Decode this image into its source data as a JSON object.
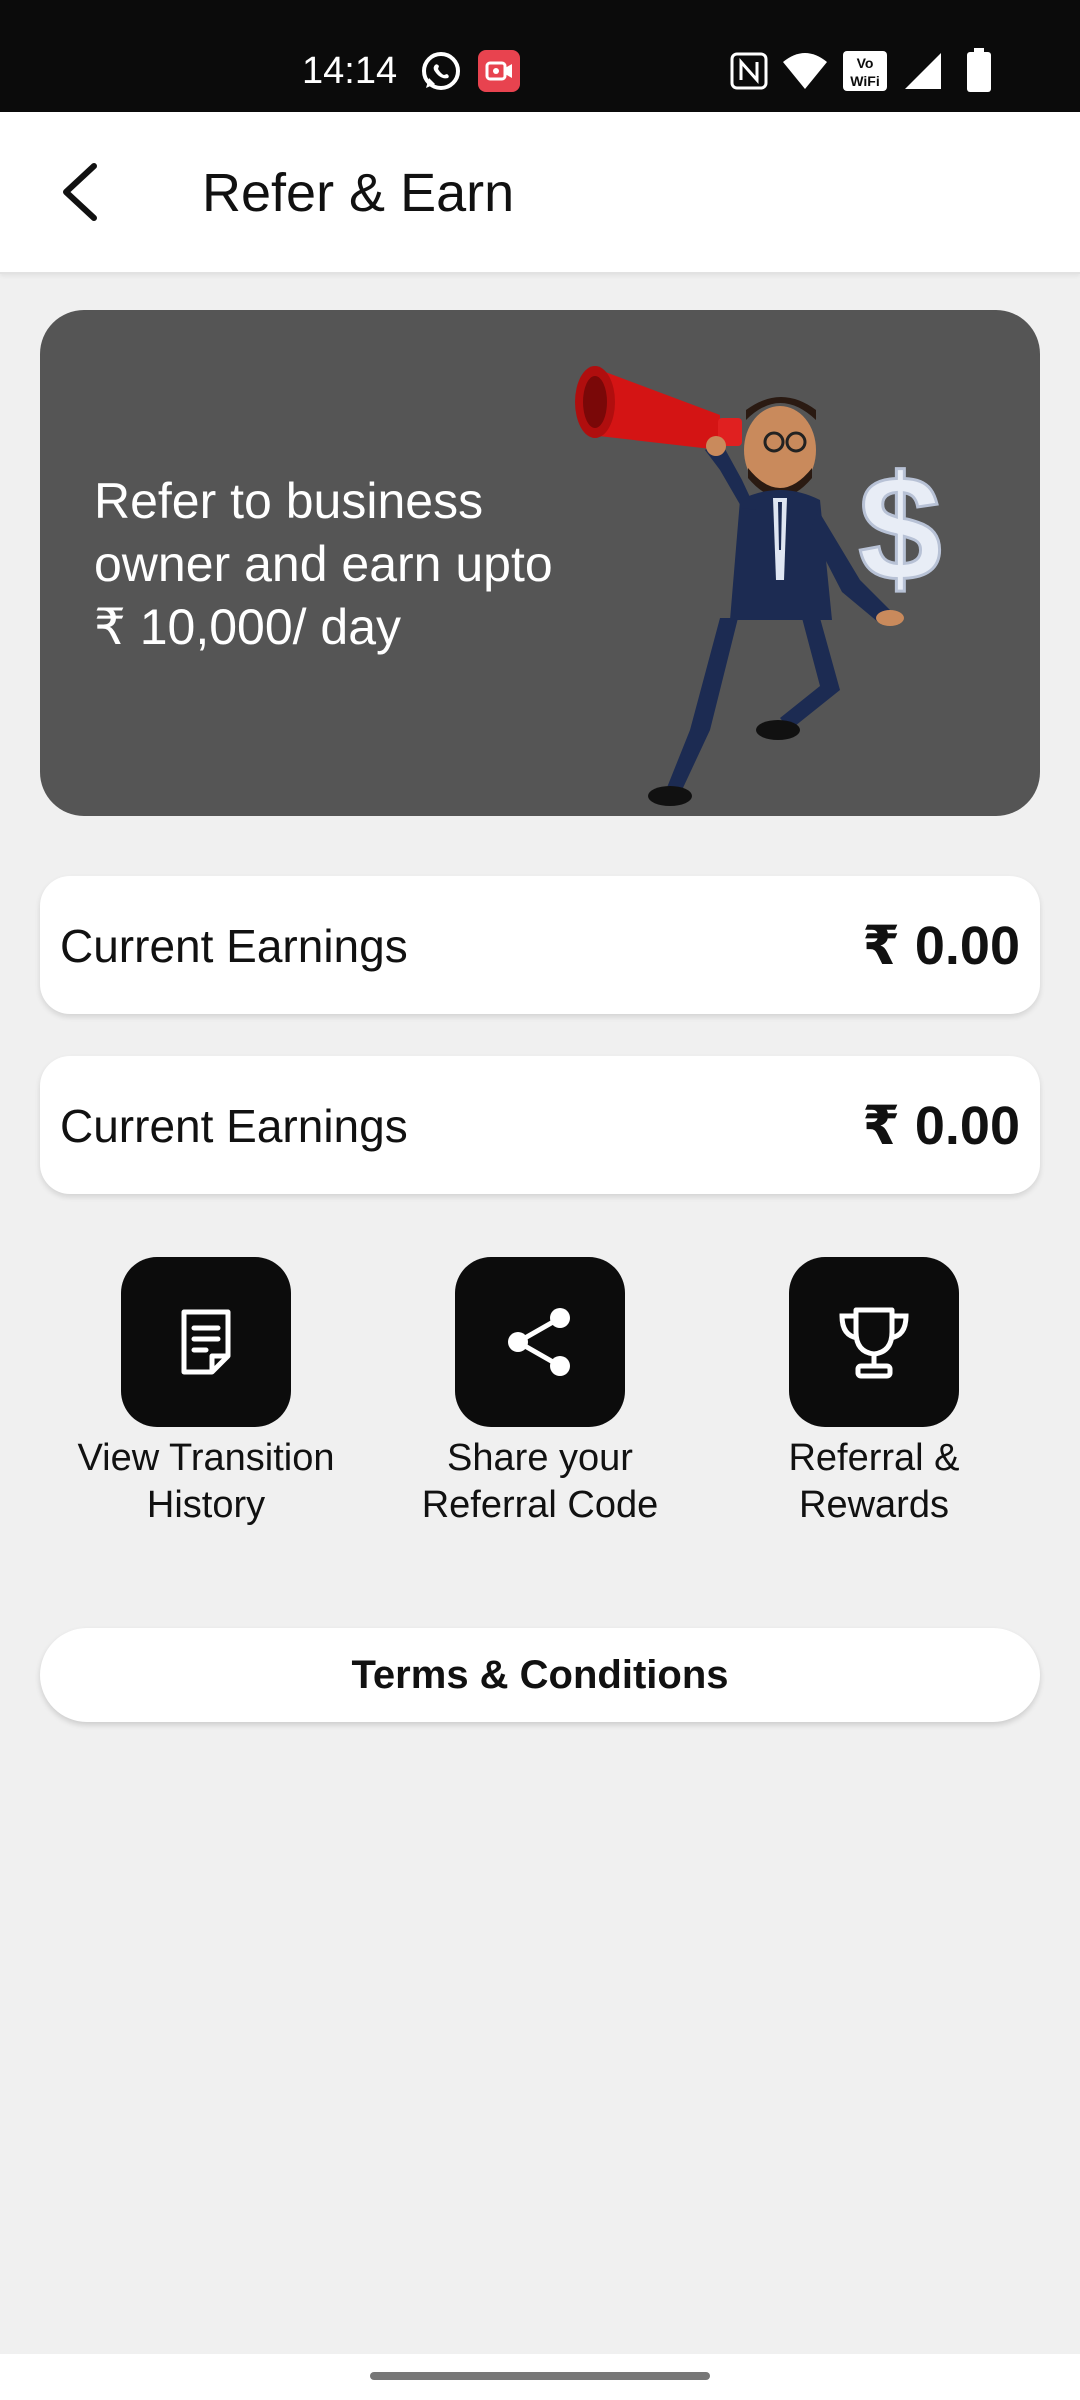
{
  "status_bar": {
    "time": "14:14",
    "icons": [
      "whatsapp-icon",
      "screen-record-icon",
      "nfc-icon",
      "wifi-icon",
      "vowifi-icon",
      "signal-icon",
      "battery-icon"
    ]
  },
  "header": {
    "back_icon": "arrow-left-icon",
    "title": "Refer & Earn"
  },
  "banner": {
    "line1": "Refer to business",
    "line2": "owner and earn upto",
    "line3": "₹ 10,000/ day",
    "illustration": "man-with-megaphone-and-dollar-illustration"
  },
  "earnings": [
    {
      "label": "Current Earnings",
      "value": "₹ 0.00"
    },
    {
      "label": "Current Earnings",
      "value": "₹ 0.00"
    }
  ],
  "actions": [
    {
      "icon": "document-icon",
      "line1": "View Transition",
      "line2": "History"
    },
    {
      "icon": "share-icon",
      "line1": "Share your",
      "line2": "Referral Code"
    },
    {
      "icon": "trophy-icon",
      "line1": "Referral &",
      "line2": "Rewards"
    }
  ],
  "terms_button": "Terms & Conditions",
  "colors": {
    "background": "#f0f0f0",
    "banner": "#555555",
    "action_tile": "#0c0c0c",
    "megaphone": "#d41414"
  }
}
